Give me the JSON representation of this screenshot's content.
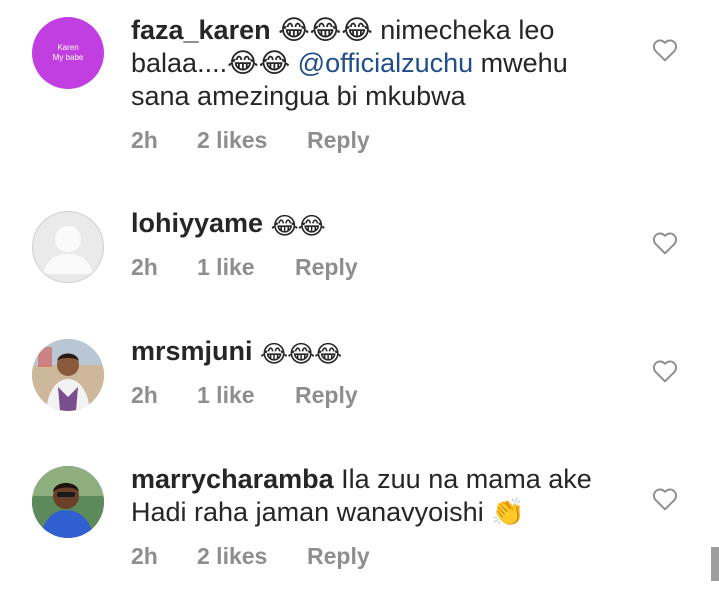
{
  "comments": [
    {
      "username": "faza_karen",
      "avatar_text_1": "Karen",
      "avatar_text_2": "My babe",
      "text_1": "😂😂😂 nimecheka leo balaa....😂😂 ",
      "mention": "@officialzuchu",
      "text_2": " mwehu sana amezingua bi mkubwa",
      "time": "2h",
      "likes": "2 likes",
      "reply": "Reply"
    },
    {
      "username": "lohiyyame",
      "text": "😂😂",
      "time": "2h",
      "likes": "1 like",
      "reply": "Reply"
    },
    {
      "username": "mrsmjuni",
      "text": "😂😂😂",
      "time": "2h",
      "likes": "1 like",
      "reply": "Reply"
    },
    {
      "username": "marrycharamba",
      "text": "Ila zuu na mama ake Hadi raha jaman wanavyoishi 👏",
      "time": "2h",
      "likes": "2 likes",
      "reply": "Reply"
    }
  ],
  "colors": {
    "meta_gray": "#8e8e8e",
    "mention_blue": "#1f4e8a",
    "avatar_purple": "#c13fe0"
  },
  "icons": [
    "heart-icon",
    "default-avatar-icon"
  ]
}
